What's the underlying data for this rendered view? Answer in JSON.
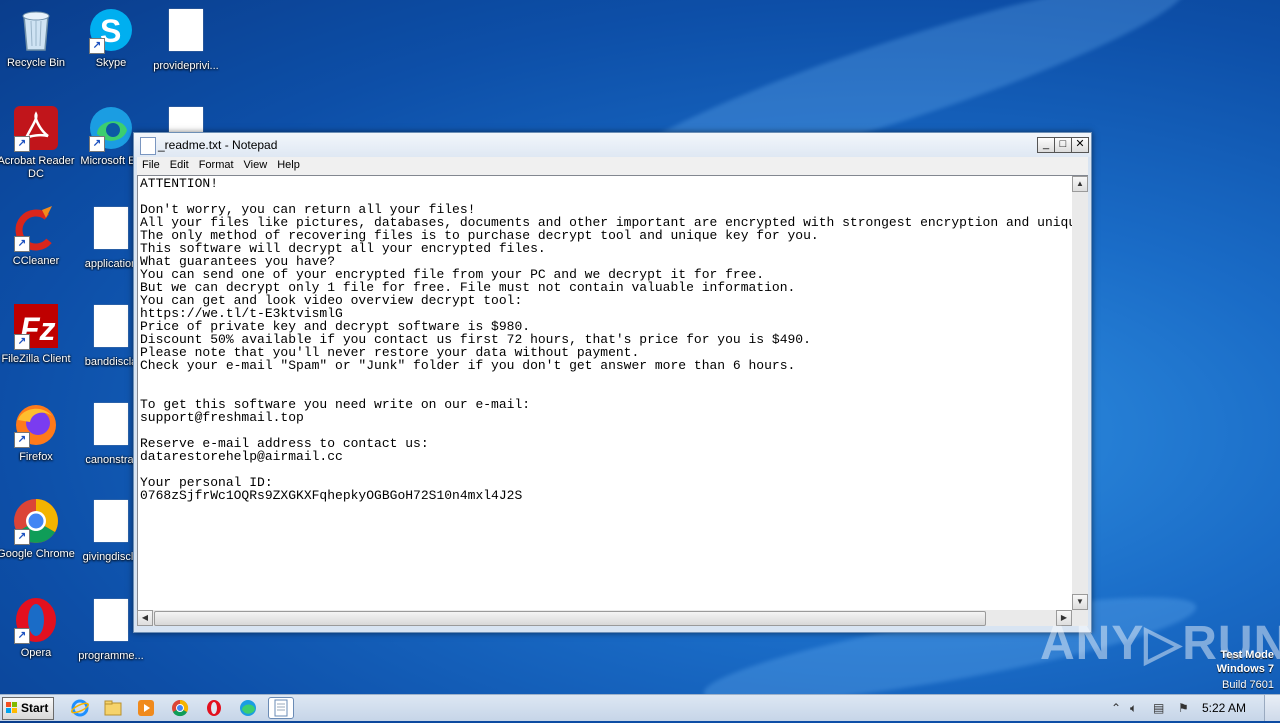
{
  "desktop": {
    "icons": [
      {
        "label": "Recycle Bin",
        "icon": "recycle-bin-icon"
      },
      {
        "label": "Skype",
        "icon": "skype-icon"
      },
      {
        "label": "provideprivi...",
        "icon": "document-icon"
      },
      {
        "label": "Acrobat Reader DC",
        "icon": "acrobat-icon"
      },
      {
        "label": "Microsoft Ed",
        "icon": "edge-icon"
      },
      {
        "label": "CCleaner",
        "icon": "ccleaner-icon"
      },
      {
        "label": "application",
        "icon": "document-icon"
      },
      {
        "label": "FileZilla Client",
        "icon": "filezilla-icon"
      },
      {
        "label": "banddiscla",
        "icon": "document-icon"
      },
      {
        "label": "Firefox",
        "icon": "firefox-icon"
      },
      {
        "label": "canonstrat",
        "icon": "document-icon"
      },
      {
        "label": "Google Chrome",
        "icon": "chrome-icon"
      },
      {
        "label": "givingdiscla",
        "icon": "document-icon"
      },
      {
        "label": "Opera",
        "icon": "opera-icon"
      },
      {
        "label": "programme...",
        "icon": "document-icon"
      }
    ]
  },
  "notepad": {
    "title": "_readme.txt - Notepad",
    "menu": [
      "File",
      "Edit",
      "Format",
      "View",
      "Help"
    ],
    "content": "ATTENTION!\n\nDon't worry, you can return all your files!\nAll your files like pictures, databases, documents and other important are encrypted with strongest encryption and unique key.\nThe only method of recovering files is to purchase decrypt tool and unique key for you.\nThis software will decrypt all your encrypted files.\nWhat guarantees you have?\nYou can send one of your encrypted file from your PC and we decrypt it for free.\nBut we can decrypt only 1 file for free. File must not contain valuable information.\nYou can get and look video overview decrypt tool:\nhttps://we.tl/t-E3ktvismlG\nPrice of private key and decrypt software is $980.\nDiscount 50% available if you contact us first 72 hours, that's price for you is $490.\nPlease note that you'll never restore your data without payment.\nCheck your e-mail \"Spam\" or \"Junk\" folder if you don't get answer more than 6 hours.\n\n\nTo get this software you need write on our e-mail:\nsupport@freshmail.top\n\nReserve e-mail address to contact us:\ndatarestorehelp@airmail.cc\n\nYour personal ID:\n0768zSjfrWc1OQRs9ZXGKXFqhepkyOGBGoH72S10n4mxl4J2S"
  },
  "watermark": {
    "text": "ANY▷RUN"
  },
  "os_info": {
    "line1": "Test Mode",
    "line2": "Windows 7",
    "line3": "Build 7601"
  },
  "taskbar": {
    "start_label": "Start",
    "pinned": [
      "ie-icon",
      "explorer-icon",
      "media-player-icon",
      "chrome-icon",
      "opera-icon",
      "edge-icon",
      "notepad-icon"
    ],
    "clock": "5:22 AM"
  }
}
